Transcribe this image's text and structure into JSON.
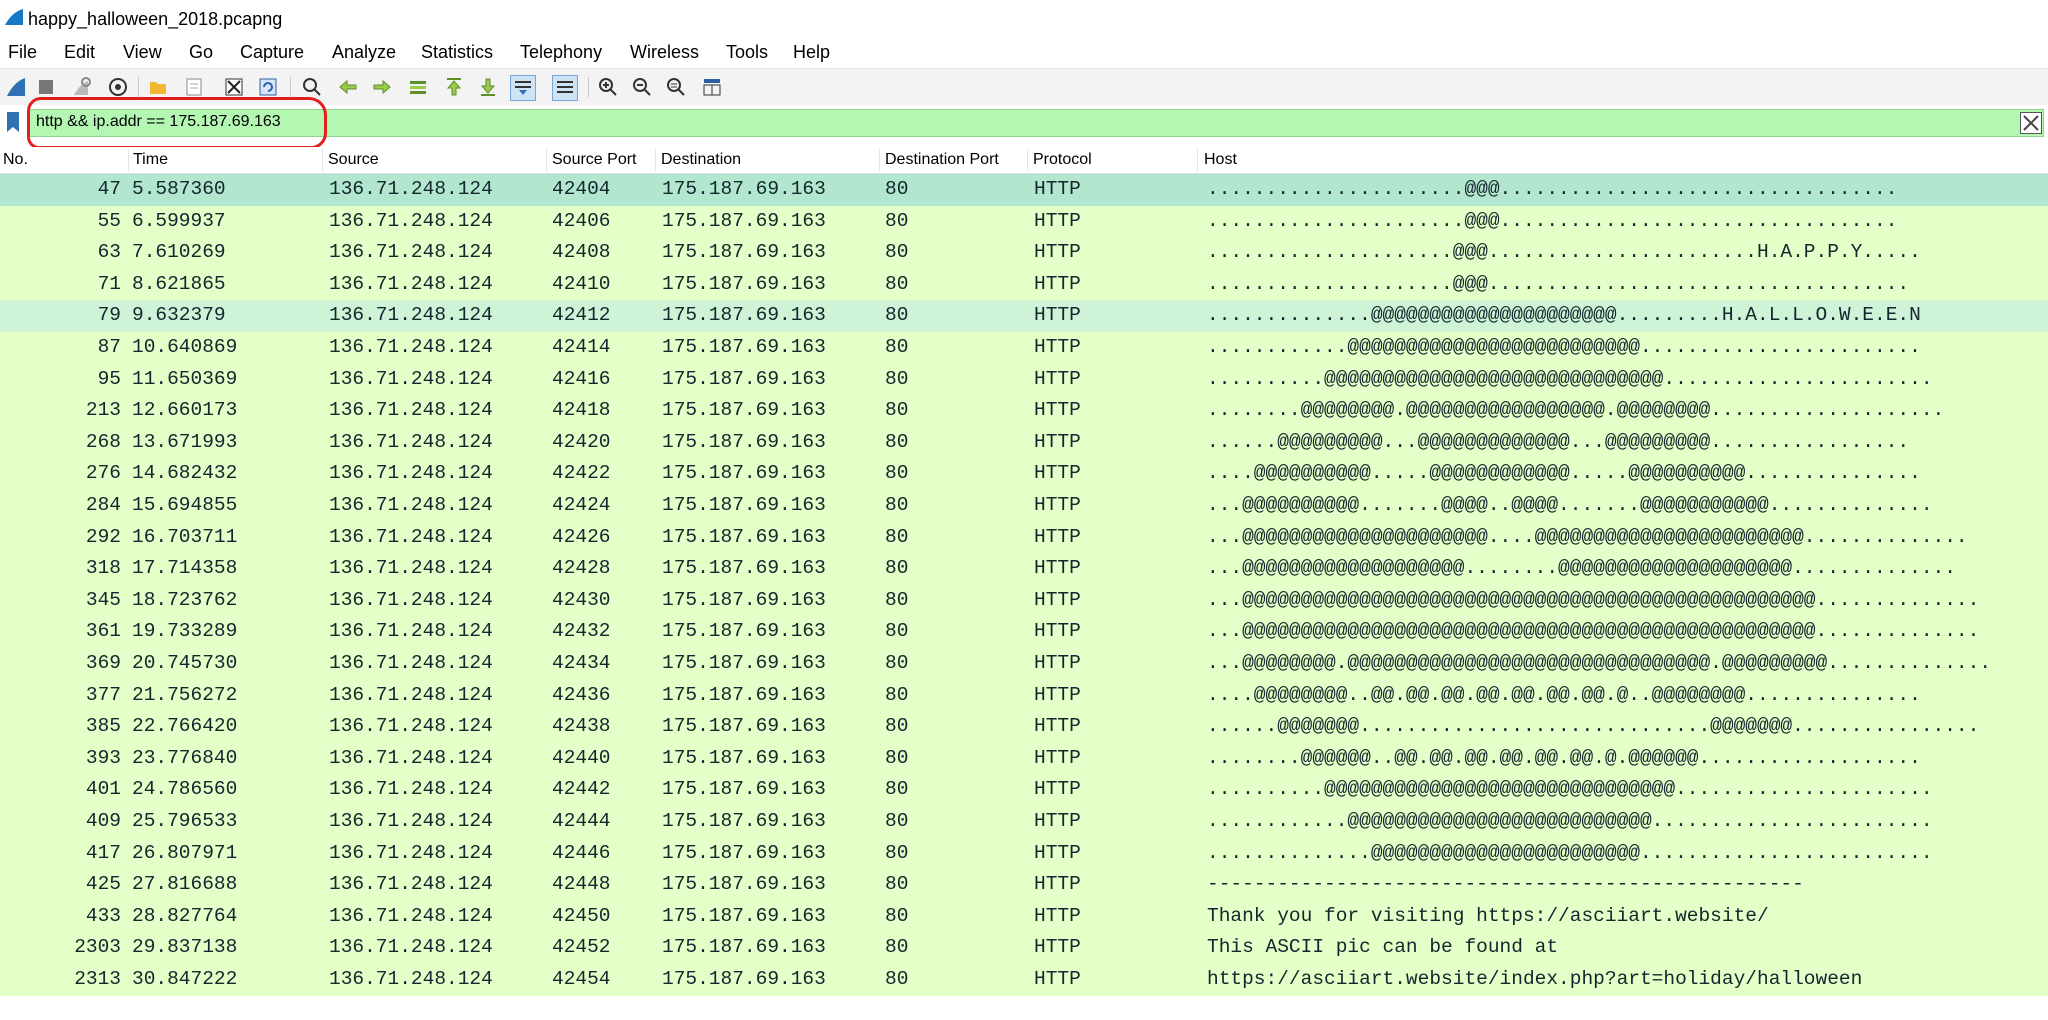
{
  "window": {
    "title": "happy_halloween_2018.pcapng",
    "icon": "wireshark-fin-icon"
  },
  "menu": [
    "File",
    "Edit",
    "View",
    "Go",
    "Capture",
    "Analyze",
    "Statistics",
    "Telephony",
    "Wireless",
    "Tools",
    "Help"
  ],
  "toolbar": {
    "icons": [
      "start-capture-icon",
      "stop-capture-icon",
      "restart-capture-icon",
      "capture-options-icon",
      "open-file-icon",
      "save-file-icon",
      "close-file-icon",
      "reload-file-icon",
      "find-packet-icon",
      "go-back-icon",
      "go-forward-icon",
      "go-to-packet-icon",
      "first-packet-icon",
      "last-packet-icon",
      "autoscroll-icon",
      "colorize-icon",
      "zoom-in-icon",
      "zoom-out-icon",
      "normal-size-icon",
      "resize-columns-icon"
    ]
  },
  "filter": {
    "value": "http && ip.addr == 175.187.69.163",
    "background": "#b3f7b3"
  },
  "columns": [
    "No.",
    "Time",
    "Source",
    "Source Port",
    "Destination",
    "Destination Port",
    "Protocol",
    "Host"
  ],
  "colors": {
    "row_bg": "#e4ffc7",
    "selected_bg": "#b3e6cf",
    "annotation": "#e0201f"
  },
  "packets": [
    {
      "no": "47",
      "time": "5.587360",
      "src": "136.71.248.124",
      "sport": "42404",
      "dst": "175.187.69.163",
      "dport": "80",
      "proto": "HTTP",
      "host": "......................@@@.................................."
    },
    {
      "no": "55",
      "time": "6.599937",
      "src": "136.71.248.124",
      "sport": "42406",
      "dst": "175.187.69.163",
      "dport": "80",
      "proto": "HTTP",
      "host": "......................@@@.................................."
    },
    {
      "no": "63",
      "time": "7.610269",
      "src": "136.71.248.124",
      "sport": "42408",
      "dst": "175.187.69.163",
      "dport": "80",
      "proto": "HTTP",
      "host": ".....................@@@.......................H.A.P.P.Y....."
    },
    {
      "no": "71",
      "time": "8.621865",
      "src": "136.71.248.124",
      "sport": "42410",
      "dst": "175.187.69.163",
      "dport": "80",
      "proto": "HTTP",
      "host": ".....................@@@...................................."
    },
    {
      "no": "79",
      "time": "9.632379",
      "src": "136.71.248.124",
      "sport": "42412",
      "dst": "175.187.69.163",
      "dport": "80",
      "proto": "HTTP",
      "host": "..............@@@@@@@@@@@@@@@@@@@@@.........H.A.L.L.O.W.E.E.N"
    },
    {
      "no": "87",
      "time": "10.640869",
      "src": "136.71.248.124",
      "sport": "42414",
      "dst": "175.187.69.163",
      "dport": "80",
      "proto": "HTTP",
      "host": "............@@@@@@@@@@@@@@@@@@@@@@@@@........................"
    },
    {
      "no": "95",
      "time": "11.650369",
      "src": "136.71.248.124",
      "sport": "42416",
      "dst": "175.187.69.163",
      "dport": "80",
      "proto": "HTTP",
      "host": "..........@@@@@@@@@@@@@@@@@@@@@@@@@@@@@......................."
    },
    {
      "no": "213",
      "time": "12.660173",
      "src": "136.71.248.124",
      "sport": "42418",
      "dst": "175.187.69.163",
      "dport": "80",
      "proto": "HTTP",
      "host": "........@@@@@@@@.@@@@@@@@@@@@@@@@@.@@@@@@@@...................."
    },
    {
      "no": "268",
      "time": "13.671993",
      "src": "136.71.248.124",
      "sport": "42420",
      "dst": "175.187.69.163",
      "dport": "80",
      "proto": "HTTP",
      "host": "......@@@@@@@@@...@@@@@@@@@@@@@...@@@@@@@@@................."
    },
    {
      "no": "276",
      "time": "14.682432",
      "src": "136.71.248.124",
      "sport": "42422",
      "dst": "175.187.69.163",
      "dport": "80",
      "proto": "HTTP",
      "host": "....@@@@@@@@@@.....@@@@@@@@@@@@.....@@@@@@@@@@..............."
    },
    {
      "no": "284",
      "time": "15.694855",
      "src": "136.71.248.124",
      "sport": "42424",
      "dst": "175.187.69.163",
      "dport": "80",
      "proto": "HTTP",
      "host": "...@@@@@@@@@@.......@@@@..@@@@.......@@@@@@@@@@@.............."
    },
    {
      "no": "292",
      "time": "16.703711",
      "src": "136.71.248.124",
      "sport": "42426",
      "dst": "175.187.69.163",
      "dport": "80",
      "proto": "HTTP",
      "host": "...@@@@@@@@@@@@@@@@@@@@@....@@@@@@@@@@@@@@@@@@@@@@@.............."
    },
    {
      "no": "318",
      "time": "17.714358",
      "src": "136.71.248.124",
      "sport": "42428",
      "dst": "175.187.69.163",
      "dport": "80",
      "proto": "HTTP",
      "host": "...@@@@@@@@@@@@@@@@@@@........@@@@@@@@@@@@@@@@@@@@.............."
    },
    {
      "no": "345",
      "time": "18.723762",
      "src": "136.71.248.124",
      "sport": "42430",
      "dst": "175.187.69.163",
      "dport": "80",
      "proto": "HTTP",
      "host": "...@@@@@@@@@@@@@@@@@@@@@@@@@@@@@@@@@@@@@@@@@@@@@@@@@.............."
    },
    {
      "no": "361",
      "time": "19.733289",
      "src": "136.71.248.124",
      "sport": "42432",
      "dst": "175.187.69.163",
      "dport": "80",
      "proto": "HTTP",
      "host": "...@@@@@@@@@@@@@@@@@@@@@@@@@@@@@@@@@@@@@@@@@@@@@@@@@.............."
    },
    {
      "no": "369",
      "time": "20.745730",
      "src": "136.71.248.124",
      "sport": "42434",
      "dst": "175.187.69.163",
      "dport": "80",
      "proto": "HTTP",
      "host": "...@@@@@@@@.@@@@@@@@@@@@@@@@@@@@@@@@@@@@@@@.@@@@@@@@@.............."
    },
    {
      "no": "377",
      "time": "21.756272",
      "src": "136.71.248.124",
      "sport": "42436",
      "dst": "175.187.69.163",
      "dport": "80",
      "proto": "HTTP",
      "host": "....@@@@@@@@..@@.@@.@@.@@.@@.@@.@@.@..@@@@@@@@..............."
    },
    {
      "no": "385",
      "time": "22.766420",
      "src": "136.71.248.124",
      "sport": "42438",
      "dst": "175.187.69.163",
      "dport": "80",
      "proto": "HTTP",
      "host": "......@@@@@@@..............................@@@@@@@................"
    },
    {
      "no": "393",
      "time": "23.776840",
      "src": "136.71.248.124",
      "sport": "42440",
      "dst": "175.187.69.163",
      "dport": "80",
      "proto": "HTTP",
      "host": "........@@@@@@..@@.@@.@@.@@.@@.@@.@.@@@@@@..................."
    },
    {
      "no": "401",
      "time": "24.786560",
      "src": "136.71.248.124",
      "sport": "42442",
      "dst": "175.187.69.163",
      "dport": "80",
      "proto": "HTTP",
      "host": "..........@@@@@@@@@@@@@@@@@@@@@@@@@@@@@@......................"
    },
    {
      "no": "409",
      "time": "25.796533",
      "src": "136.71.248.124",
      "sport": "42444",
      "dst": "175.187.69.163",
      "dport": "80",
      "proto": "HTTP",
      "host": "............@@@@@@@@@@@@@@@@@@@@@@@@@@........................"
    },
    {
      "no": "417",
      "time": "26.807971",
      "src": "136.71.248.124",
      "sport": "42446",
      "dst": "175.187.69.163",
      "dport": "80",
      "proto": "HTTP",
      "host": "..............@@@@@@@@@@@@@@@@@@@@@@@........................."
    },
    {
      "no": "425",
      "time": "27.816688",
      "src": "136.71.248.124",
      "sport": "42448",
      "dst": "175.187.69.163",
      "dport": "80",
      "proto": "HTTP",
      "host": "---------------------------------------------------"
    },
    {
      "no": "433",
      "time": "28.827764",
      "src": "136.71.248.124",
      "sport": "42450",
      "dst": "175.187.69.163",
      "dport": "80",
      "proto": "HTTP",
      "host": "Thank you for visiting https://asciiart.website/"
    },
    {
      "no": "2303",
      "time": "29.837138",
      "src": "136.71.248.124",
      "sport": "42452",
      "dst": "175.187.69.163",
      "dport": "80",
      "proto": "HTTP",
      "host": "This ASCII pic can be found at"
    },
    {
      "no": "2313",
      "time": "30.847222",
      "src": "136.71.248.124",
      "sport": "42454",
      "dst": "175.187.69.163",
      "dport": "80",
      "proto": "HTTP",
      "host": "https://asciiart.website/index.php?art=holiday/halloween"
    }
  ]
}
